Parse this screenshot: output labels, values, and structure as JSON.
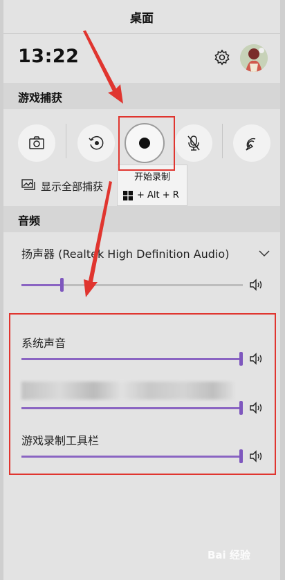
{
  "window": {
    "title": "桌面"
  },
  "header": {
    "time": "13:22",
    "settings_icon": "gear-icon",
    "avatar_icon": "user-avatar"
  },
  "capture": {
    "section_label": "游戏捕获",
    "buttons": [
      {
        "name": "screenshot-button",
        "icon": "camera-icon"
      },
      {
        "name": "record-last-button",
        "icon": "record-last-icon"
      },
      {
        "name": "start-recording-button",
        "icon": "record-dot-icon"
      },
      {
        "name": "mic-button",
        "icon": "mic-off-icon"
      },
      {
        "name": "broadcast-button",
        "icon": "broadcast-icon"
      }
    ],
    "show_all_label": "显示全部捕获",
    "tooltip": {
      "title": "开始录制",
      "shortcut": "+ Alt + R"
    }
  },
  "audio": {
    "section_label": "音频",
    "device": "扬声器 (Realtek High Definition Audio)",
    "master_level": 0.19,
    "apps": [
      {
        "label": "系统声音",
        "level": 1.0
      },
      {
        "label": "",
        "level": 1.0
      },
      {
        "label": "游戏录制工具栏",
        "level": 1.0
      }
    ]
  },
  "annotation": {
    "color": "#e0352f"
  },
  "accent": "#8a64c2",
  "watermark": "Bai 经验"
}
